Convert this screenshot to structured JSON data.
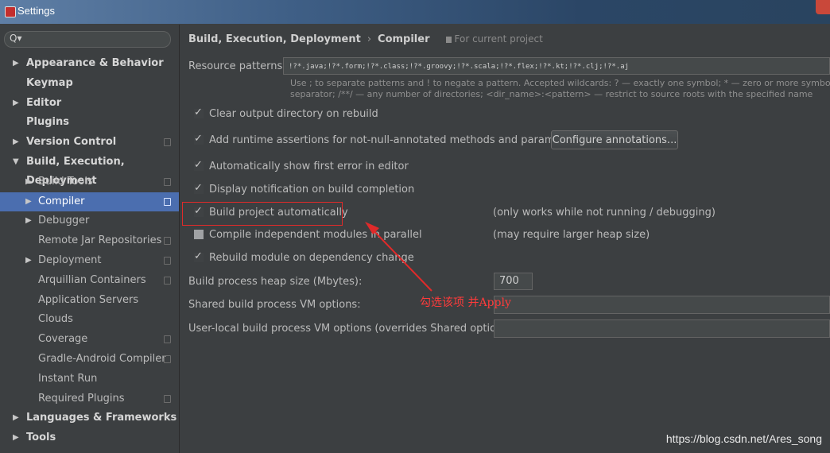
{
  "window": {
    "title": "Settings"
  },
  "search": {
    "placeholder": "Q▾"
  },
  "sidebar": {
    "items": [
      {
        "label": "Appearance & Behavior",
        "arrow": "▶",
        "bold": true
      },
      {
        "label": "Keymap",
        "arrow": "",
        "bold": true
      },
      {
        "label": "Editor",
        "arrow": "▶",
        "bold": true
      },
      {
        "label": "Plugins",
        "arrow": "",
        "bold": true
      },
      {
        "label": "Version Control",
        "arrow": "▶",
        "bold": true
      },
      {
        "label": "Build, Execution, Deployment",
        "arrow": "▼",
        "bold": true
      },
      {
        "label": "Build Tools",
        "arrow": "▶"
      },
      {
        "label": "Compiler",
        "arrow": "▶",
        "selected": true
      },
      {
        "label": "Debugger",
        "arrow": "▶"
      },
      {
        "label": "Remote Jar Repositories",
        "arrow": ""
      },
      {
        "label": "Deployment",
        "arrow": "▶"
      },
      {
        "label": "Arquillian Containers",
        "arrow": ""
      },
      {
        "label": "Application Servers",
        "arrow": ""
      },
      {
        "label": "Clouds",
        "arrow": ""
      },
      {
        "label": "Coverage",
        "arrow": ""
      },
      {
        "label": "Gradle-Android Compiler",
        "arrow": ""
      },
      {
        "label": "Instant Run",
        "arrow": ""
      },
      {
        "label": "Required Plugins",
        "arrow": ""
      },
      {
        "label": "Languages & Frameworks",
        "arrow": "▶",
        "bold": true
      },
      {
        "label": "Tools",
        "arrow": "▶",
        "bold": true
      }
    ]
  },
  "breadcrumb": {
    "section": "Build, Execution, Deployment",
    "separator": "›",
    "page": "Compiler",
    "scope": "For current project"
  },
  "resource_patterns": {
    "label": "Resource patterns:",
    "value": "!?*.java;!?*.form;!?*.class;!?*.groovy;!?*.scala;!?*.flex;!?*.kt;!?*.clj;!?*.aj",
    "hint_line1": "Use ; to separate patterns and ! to negate a pattern. Accepted wildcards: ? — exactly one symbol; * — zero or more symbols; / — pa",
    "hint_line2": "separator; /**/ — any number of directories; <dir_name>:<pattern> — restrict to source roots with the specified name"
  },
  "options": {
    "clear_output": {
      "label": "Clear output directory on rebuild",
      "checked": true
    },
    "runtime_assertions": {
      "label": "Add runtime assertions for not-null-annotated methods and parameters",
      "checked": true
    },
    "configure_annotations": "Configure annotations...",
    "show_first_error": {
      "label": "Automatically show first error in editor",
      "checked": true
    },
    "display_notification": {
      "label": "Display notification on build completion",
      "checked": true
    },
    "build_automatically": {
      "label": "Build project automatically",
      "checked": true,
      "note": "(only works while not running / debugging)"
    },
    "compile_parallel": {
      "label": "Compile independent modules in parallel",
      "checked": false,
      "note": "(may require larger heap size)"
    },
    "rebuild_on_dependency": {
      "label": "Rebuild module on dependency change",
      "checked": true
    }
  },
  "heap_size": {
    "label": "Build process heap size (Mbytes):",
    "value": "700"
  },
  "shared_vm": {
    "label": "Shared build process VM options:",
    "value": ""
  },
  "user_local_vm": {
    "label": "User-local build process VM options (overrides Shared options):",
    "value": ""
  },
  "annotation": {
    "text": "勾选该项 并Apply",
    "color": "#ff3b3b"
  },
  "watermark": "https://blog.csdn.net/Ares_song",
  "colors": {
    "selection": "#4b6eaf",
    "background": "#3c3f41",
    "highlight": "#e02a2a"
  }
}
